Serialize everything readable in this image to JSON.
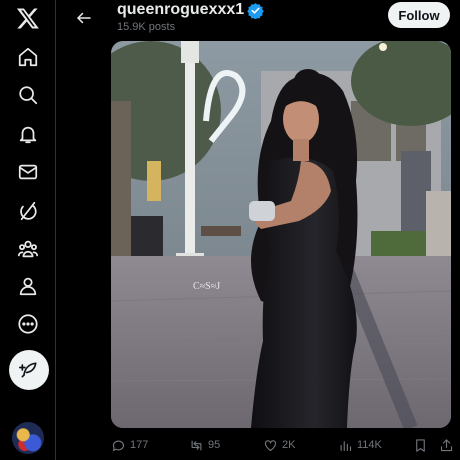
{
  "profile": {
    "username": "queenroguexxx1",
    "posts_count": "15.9K posts",
    "follow_label": "Follow",
    "verified_color": "#1d9bf0"
  },
  "sidebar": {
    "items": [
      {
        "icon": "x-logo-icon"
      },
      {
        "icon": "home-icon"
      },
      {
        "icon": "search-icon"
      },
      {
        "icon": "bell-icon"
      },
      {
        "icon": "mail-icon"
      },
      {
        "icon": "grok-icon"
      },
      {
        "icon": "communities-icon"
      },
      {
        "icon": "profile-icon"
      },
      {
        "icon": "more-icon"
      }
    ],
    "post_button_icon": "feather-plus-icon"
  },
  "photo": {
    "watermark": "C≈S≈J"
  },
  "actions": {
    "replies": "177",
    "reposts": "95",
    "likes": "2K",
    "views": "114K"
  },
  "colors": {
    "background": "#000000",
    "text": "#e7e9ea",
    "muted": "#71767b",
    "button": "#eff3f4"
  }
}
